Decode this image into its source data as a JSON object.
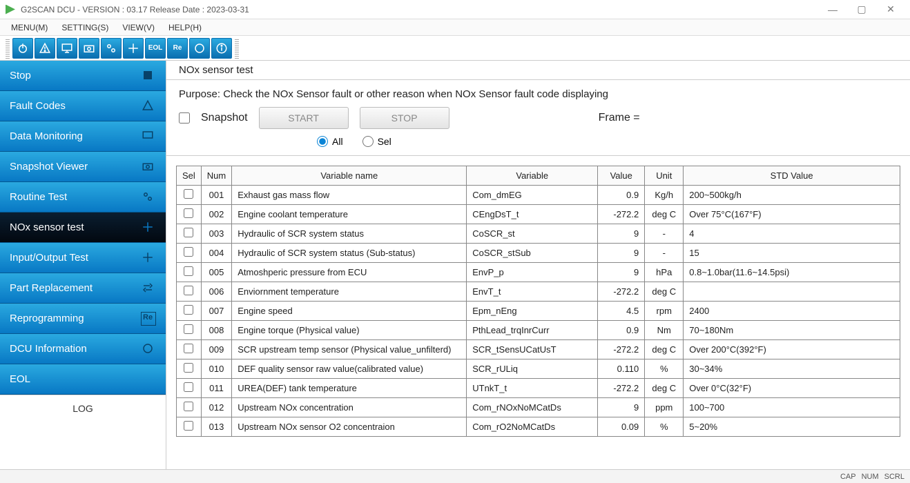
{
  "window": {
    "title": "G2SCAN DCU - VERSION : 03.17 Release Date : 2023-03-31"
  },
  "menu": {
    "items": [
      "MENU(M)",
      "SETTING(S)",
      "VIEW(V)",
      "HELP(H)"
    ]
  },
  "sidebar": {
    "items": [
      {
        "label": "Stop"
      },
      {
        "label": "Fault Codes"
      },
      {
        "label": "Data Monitoring"
      },
      {
        "label": "Snapshot Viewer"
      },
      {
        "label": "Routine Test"
      },
      {
        "label": "NOx sensor test"
      },
      {
        "label": "Input/Output Test"
      },
      {
        "label": "Part Replacement"
      },
      {
        "label": "Reprogramming"
      },
      {
        "label": "DCU Information"
      },
      {
        "label": "EOL"
      }
    ],
    "log_label": "LOG"
  },
  "main": {
    "title": "NOx sensor test",
    "purpose": "Purpose: Check the NOx Sensor fault or other reason when NOx Sensor fault code displaying",
    "snapshot_label": "Snapshot",
    "start_label": "START",
    "stop_label": "STOP",
    "frame_label": "Frame =",
    "radio_all": "All",
    "radio_sel": "Sel"
  },
  "table": {
    "headers": {
      "sel": "Sel",
      "num": "Num",
      "vname": "Variable name",
      "var": "Variable",
      "val": "Value",
      "unit": "Unit",
      "std": "STD Value"
    },
    "rows": [
      {
        "num": "001",
        "vname": "Exhaust gas mass flow",
        "var": "Com_dmEG",
        "val": "0.9",
        "unit": "Kg/h",
        "std": "200~500kg/h"
      },
      {
        "num": "002",
        "vname": "Engine coolant temperature",
        "var": "CEngDsT_t",
        "val": "-272.2",
        "unit": "deg C",
        "std": "Over 75°C(167°F)"
      },
      {
        "num": "003",
        "vname": "Hydraulic of SCR system status",
        "var": "CoSCR_st",
        "val": "9",
        "unit": "-",
        "std": "4"
      },
      {
        "num": "004",
        "vname": "Hydraulic of SCR system status (Sub-status)",
        "var": "CoSCR_stSub",
        "val": "9",
        "unit": "-",
        "std": "15"
      },
      {
        "num": "005",
        "vname": "Atmoshperic pressure from ECU",
        "var": "EnvP_p",
        "val": "9",
        "unit": "hPa",
        "std": "0.8~1.0bar(11.6~14.5psi)"
      },
      {
        "num": "006",
        "vname": "Enviornment temperature",
        "var": "EnvT_t",
        "val": "-272.2",
        "unit": "deg C",
        "std": ""
      },
      {
        "num": "007",
        "vname": "Engine speed",
        "var": "Epm_nEng",
        "val": "4.5",
        "unit": "rpm",
        "std": "2400"
      },
      {
        "num": "008",
        "vname": "Engine torque (Physical value)",
        "var": "PthLead_trqInrCurr",
        "val": "0.9",
        "unit": "Nm",
        "std": "70~180Nm"
      },
      {
        "num": "009",
        "vname": "SCR upstream temp sensor (Physical value_unfilterd)",
        "var": "SCR_tSensUCatUsT",
        "val": "-272.2",
        "unit": "deg C",
        "std": "Over 200°C(392°F)"
      },
      {
        "num": "010",
        "vname": "DEF quality sensor raw value(calibrated value)",
        "var": "SCR_rULiq",
        "val": "0.110",
        "unit": "%",
        "std": "30~34%"
      },
      {
        "num": "011",
        "vname": "UREA(DEF) tank temperature",
        "var": "UTnkT_t",
        "val": "-272.2",
        "unit": "deg C",
        "std": "Over 0°C(32°F)"
      },
      {
        "num": "012",
        "vname": "Upstream NOx concentration",
        "var": "Com_rNOxNoMCatDs",
        "val": "9",
        "unit": "ppm",
        "std": "100~700"
      },
      {
        "num": "013",
        "vname": "Upstream NOx sensor O2 concentraion",
        "var": "Com_rO2NoMCatDs",
        "val": "0.09",
        "unit": "%",
        "std": "5~20%"
      }
    ]
  },
  "statusbar": {
    "cap": "CAP",
    "num": "NUM",
    "scrl": "SCRL"
  }
}
